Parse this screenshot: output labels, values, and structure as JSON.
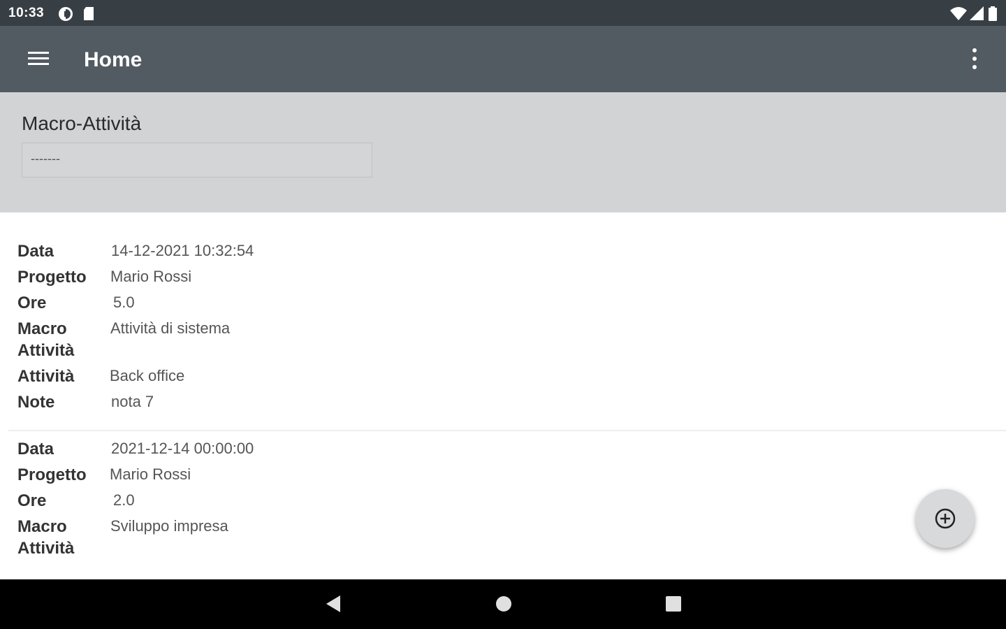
{
  "status_bar": {
    "time": "10:33",
    "left_icons": [
      "data-saver-icon",
      "sd-card-icon"
    ],
    "right_icons": [
      "wifi-icon",
      "cell-signal-icon",
      "battery-icon"
    ]
  },
  "app_bar": {
    "title": "Home",
    "menu_icon": "hamburger-menu-icon",
    "overflow_icon": "more-vert-icon",
    "color": "#525a62"
  },
  "filter": {
    "label": "Macro-Attività",
    "selected_value": "-------"
  },
  "records": [
    {
      "fields": [
        {
          "label": "Data",
          "value": "14-12-2021 10:32:54"
        },
        {
          "label": "Progetto",
          "value": "Mario Rossi"
        },
        {
          "label": "Ore",
          "value": "5.0"
        },
        {
          "label": "Macro Attività",
          "value": "Attività di sistema"
        },
        {
          "label": "Attività",
          "value": "Back office"
        },
        {
          "label": "Note",
          "value": "nota 7"
        }
      ]
    },
    {
      "fields": [
        {
          "label": "Data",
          "value": "2021-12-14 00:00:00"
        },
        {
          "label": "Progetto",
          "value": "Mario Rossi"
        },
        {
          "label": "Ore",
          "value": "2.0"
        },
        {
          "label": "Macro Attività",
          "value": "Sviluppo impresa"
        }
      ]
    }
  ],
  "fab": {
    "icon": "add-circle-icon"
  },
  "nav_bar": {
    "buttons": [
      "back-icon",
      "home-icon",
      "recents-icon"
    ]
  }
}
